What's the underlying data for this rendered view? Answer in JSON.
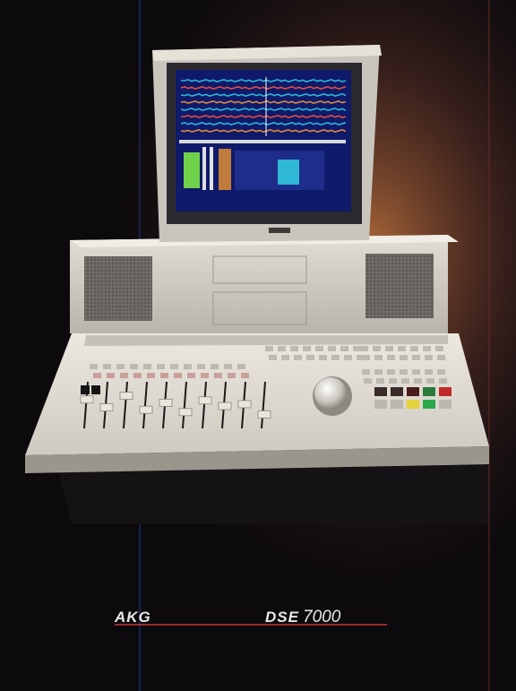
{
  "brand": "AKG",
  "model_bold": "DSE",
  "model_number": "7000",
  "colors": {
    "background": "#0c0a0d",
    "glow": "#b06a3a",
    "console": "#d9d5cc",
    "console_shadow": "#9a968e",
    "screen": "#0f1a6a",
    "brand_line": "#c8383a"
  },
  "screen_tracks": [
    "#2fb7d6",
    "#e0503a",
    "#2fb7d6",
    "#e08a3a",
    "#2fb7d6",
    "#e0503a",
    "#2fb7d6",
    "#e08a3a"
  ],
  "fader_levels": [
    0.62,
    0.45,
    0.7,
    0.4,
    0.55,
    0.35,
    0.6,
    0.48,
    0.52,
    0.3
  ],
  "icons": [
    "jog-wheel-icon",
    "speaker-grille-icon"
  ]
}
